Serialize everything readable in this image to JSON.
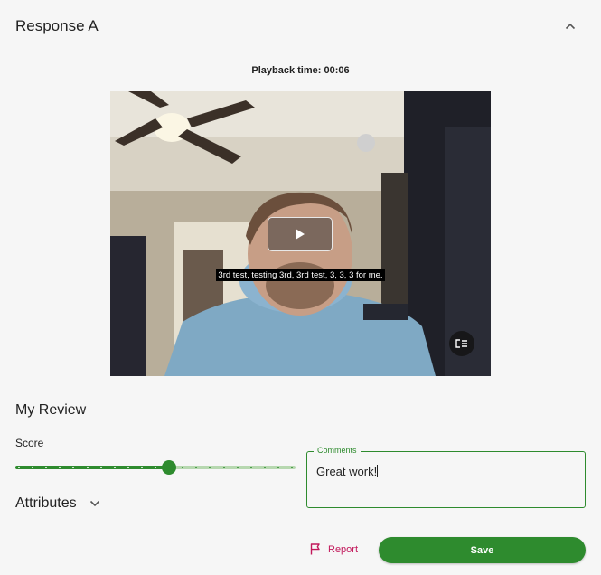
{
  "response": {
    "title": "Response A",
    "collapse_icon": "chevron-up-icon"
  },
  "player": {
    "playback_label": "Playback time: 00:06",
    "caption": "3rd test, testing 3rd, 3rd test, 3, 3, 3 for me.",
    "play_icon": "play-icon",
    "captions_icon": "closed-captions-icon"
  },
  "review": {
    "title": "My Review",
    "score_label": "Score",
    "score": {
      "value": 11,
      "min": 0,
      "max": 20,
      "steps": 21
    },
    "attributes_label": "Attributes",
    "attributes_icon": "chevron-down-icon",
    "comments_label": "Comments",
    "comments_value": "Great work!"
  },
  "actions": {
    "report_label": "Report",
    "report_icon": "flag-icon",
    "save_label": "Save"
  },
  "colors": {
    "accent": "#2e8b2e",
    "accent_light": "#b7d8b0",
    "report": "#c2185b",
    "background": "#f6f6f6"
  }
}
